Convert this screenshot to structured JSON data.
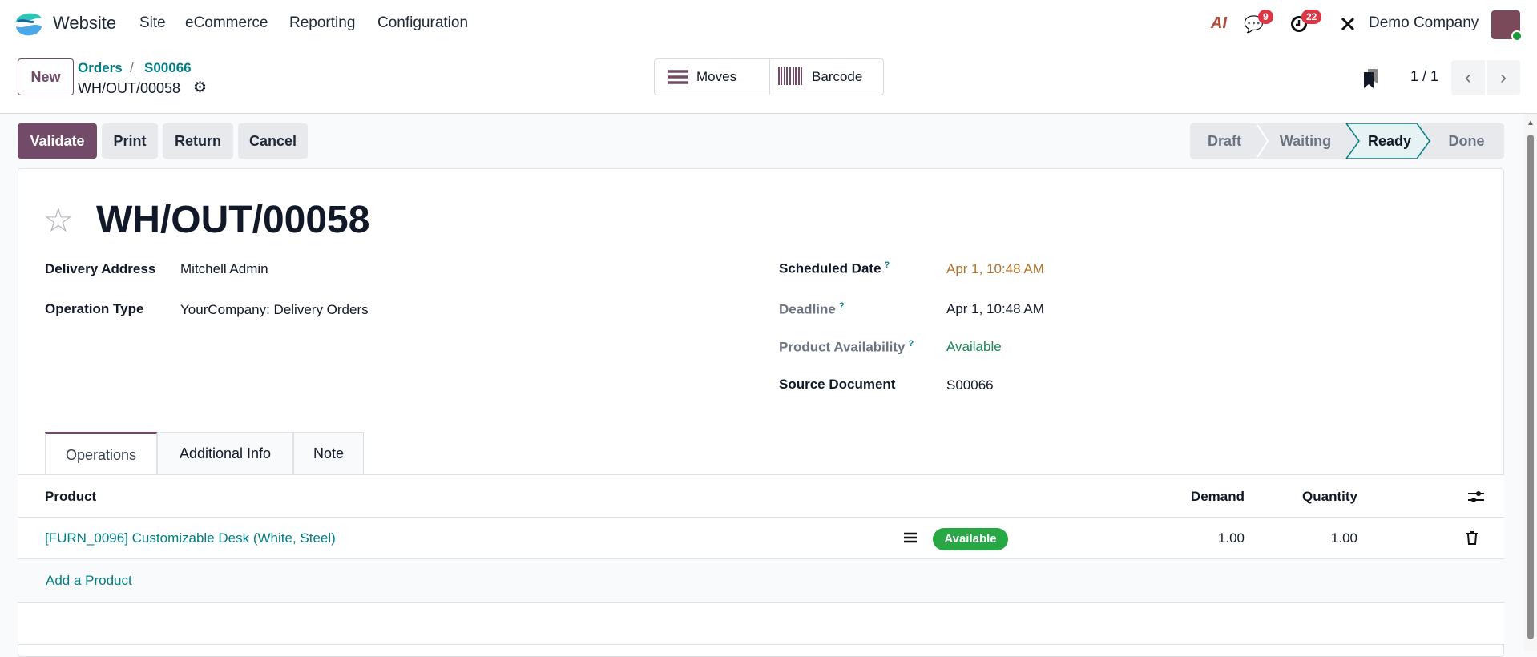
{
  "nav": {
    "app": "Website",
    "menu": [
      "Site",
      "eCommerce",
      "Reporting",
      "Configuration"
    ],
    "messages_count": "9",
    "activities_count": "22",
    "ai_label": "AI",
    "company": "Demo Company"
  },
  "control": {
    "new": "New",
    "breadcrumb": [
      "Orders",
      "S00066"
    ],
    "breadcrumb_sep": "/",
    "record": "WH/OUT/00058",
    "moves": "Moves",
    "barcode": "Barcode",
    "pager": "1 / 1"
  },
  "actions": {
    "validate": "Validate",
    "print": "Print",
    "return": "Return",
    "cancel": "Cancel"
  },
  "status": {
    "stages": [
      "Draft",
      "Waiting",
      "Ready",
      "Done"
    ],
    "current": "Ready"
  },
  "form": {
    "title": "WH/OUT/00058",
    "left": [
      {
        "label": "Delivery Address",
        "value": "Mitchell Admin"
      },
      {
        "label": "Operation Type",
        "value": "YourCompany: Delivery Orders"
      }
    ],
    "right": [
      {
        "label": "Scheduled Date",
        "value": "Apr 1, 10:48 AM",
        "help": "?"
      },
      {
        "label": "Deadline",
        "value": "Apr 1, 10:48 AM",
        "help": "?"
      },
      {
        "label": "Product Availability",
        "value": "Available",
        "help": "?"
      },
      {
        "label": "Source Document",
        "value": "S00066"
      }
    ]
  },
  "tabs": [
    "Operations",
    "Additional Info",
    "Note"
  ],
  "table": {
    "headers": {
      "product": "Product",
      "demand": "Demand",
      "quantity": "Quantity"
    },
    "rows": [
      {
        "product": "[FURN_0096] Customizable Desk (White, Steel)",
        "status": "Available",
        "demand": "1.00",
        "quantity": "1.00"
      }
    ],
    "add": "Add a Product"
  },
  "colors": {
    "primary": "#714B67",
    "link": "#017E84",
    "warning": "#B0712A",
    "success": "#28A745"
  }
}
